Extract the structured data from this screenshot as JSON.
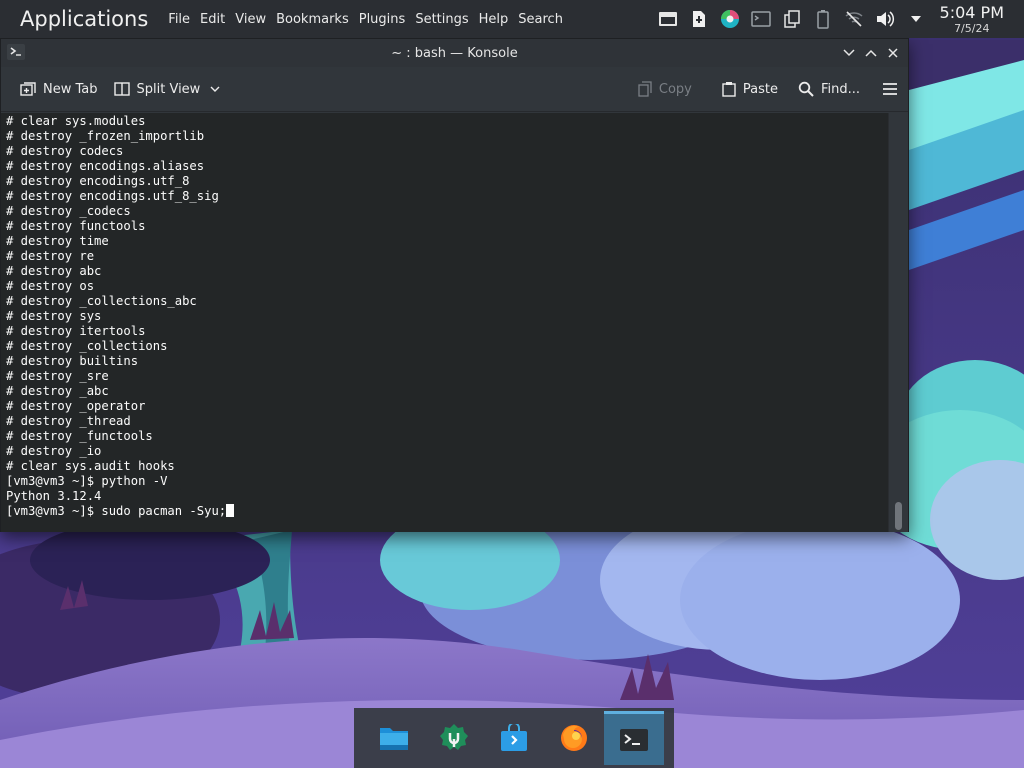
{
  "desktop": {
    "applications_label": "Applications",
    "global_menu": [
      "File",
      "Edit",
      "View",
      "Bookmarks",
      "Plugins",
      "Settings",
      "Help",
      "Search"
    ],
    "tray_icons": [
      "display-icon",
      "update-icon",
      "color-picker-icon",
      "terminal-indicator-icon",
      "clipboard-icon",
      "battery-icon",
      "network-off-icon",
      "volume-icon",
      "tray-expand-icon"
    ],
    "clock": {
      "time": "5:04 PM",
      "date": "7/5/24"
    }
  },
  "window": {
    "title": "~ : bash — Konsole",
    "toolbar": {
      "new_tab": "New Tab",
      "split_view": "Split View",
      "copy": "Copy",
      "paste": "Paste",
      "find": "Find..."
    }
  },
  "terminal": {
    "lines": [
      "# clear sys.modules",
      "# destroy _frozen_importlib",
      "# destroy codecs",
      "# destroy encodings.aliases",
      "# destroy encodings.utf_8",
      "# destroy encodings.utf_8_sig",
      "# destroy _codecs",
      "# destroy functools",
      "# destroy time",
      "# destroy re",
      "# destroy abc",
      "# destroy os",
      "# destroy _collections_abc",
      "# destroy sys",
      "# destroy itertools",
      "# destroy _collections",
      "# destroy builtins",
      "# destroy _sre",
      "# destroy _abc",
      "# destroy _operator",
      "# destroy _thread",
      "# destroy _functools",
      "# destroy _io",
      "# clear sys.audit hooks",
      "[vm3@vm3 ~]$ python -V",
      "Python 3.12.4",
      "[vm3@vm3 ~]$ sudo pacman -Syu;"
    ]
  },
  "dock": {
    "items": [
      "file-manager-icon",
      "discover-settings-icon",
      "software-store-icon",
      "firefox-icon",
      "konsole-icon"
    ],
    "active": "konsole-icon"
  },
  "colors": {
    "panel": "#2b2e33",
    "window": "#31363b",
    "terminal_bg": "#232627",
    "terminal_fg": "#fcfcfc",
    "dock_active": "#3a6d8f"
  }
}
